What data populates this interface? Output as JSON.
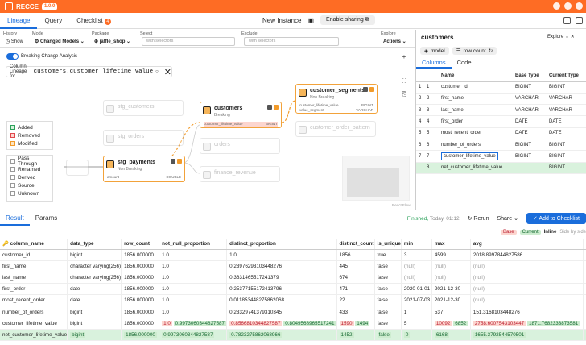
{
  "app": {
    "name": "RECCE",
    "version": "1.0.0"
  },
  "nav": {
    "tabs": [
      "Lineage",
      "Query",
      "Checklist"
    ],
    "checklist_count": "4",
    "title": "New Instance",
    "share": "Enable sharing"
  },
  "filters": {
    "history_label": "History",
    "history_value": "Show",
    "mode_label": "Mode",
    "mode_value": "Changed Models",
    "package_label": "Package",
    "package_value": "jaffle_shop",
    "select_label": "Select",
    "select_placeholder": "with selectors",
    "exclude_label": "Exclude",
    "exclude_placeholder": "with selectors",
    "explore_label": "Explore",
    "actions_value": "Actions"
  },
  "canvas": {
    "breaking_label": "Breaking Change Analysis",
    "column_lineage_label": "Column Lineage for",
    "column_lineage_value": "customers.customer_lifetime_value",
    "legend1": [
      "Added",
      "Removed",
      "Modified"
    ],
    "legend1_colors": [
      "#2ba15a",
      "#e0474c",
      "#f29b2a"
    ],
    "legend2": [
      "Pass Through",
      "Renamed",
      "Derived",
      "Source",
      "Unknown"
    ],
    "react_flow": "React Flow",
    "nodes": {
      "stg_customers": {
        "title": "stg_customers"
      },
      "stg_orders": {
        "title": "stg_orders"
      },
      "stg_payments": {
        "title": "stg_payments",
        "sub": "Non Breaking",
        "col": "amount",
        "type": "DOUBLE"
      },
      "customers": {
        "title": "customers",
        "sub": "Breaking",
        "col": "customer_lifetime_value",
        "type": "BIGINT"
      },
      "customer_segments": {
        "title": "customer_segments",
        "sub": "Non Breaking",
        "col1": "customer_lifetime_value",
        "type1": "BIGINT",
        "col2": "value_segment",
        "type2": "VARCHAR"
      },
      "customer_order_pattern": {
        "title": "customer_order_pattern"
      },
      "orders": {
        "title": "orders"
      },
      "finance_revenue": {
        "title": "finance_revenue"
      }
    }
  },
  "right_panel": {
    "title": "customers",
    "explore": "Explore",
    "badges": [
      "model",
      "row count"
    ],
    "tabs": [
      "Columns",
      "Code"
    ],
    "headers": [
      "",
      "",
      "Name",
      "Base Type",
      "Current Type"
    ],
    "rows": [
      {
        "a": "1",
        "b": "1",
        "name": "customer_id",
        "base": "BIGINT",
        "cur": "BIGINT"
      },
      {
        "a": "2",
        "b": "2",
        "name": "first_name",
        "base": "VARCHAR",
        "cur": "VARCHAR"
      },
      {
        "a": "3",
        "b": "3",
        "name": "last_name",
        "base": "VARCHAR",
        "cur": "VARCHAR"
      },
      {
        "a": "4",
        "b": "4",
        "name": "first_order",
        "base": "DATE",
        "cur": "DATE"
      },
      {
        "a": "5",
        "b": "5",
        "name": "most_recent_order",
        "base": "DATE",
        "cur": "DATE"
      },
      {
        "a": "6",
        "b": "6",
        "name": "number_of_orders",
        "base": "BIGINT",
        "cur": "BIGINT"
      },
      {
        "a": "7",
        "b": "7",
        "name": "customer_lifetime_value",
        "base": "BIGINT",
        "cur": "BIGINT"
      },
      {
        "a": "",
        "b": "8",
        "name": "net_customer_lifetime_value",
        "base": "",
        "cur": "BIGINT"
      }
    ]
  },
  "result": {
    "tabs": [
      "Result",
      "Params"
    ],
    "finished": "Finished",
    "time": "Today, 01:12",
    "rerun": "Rerun",
    "share": "Share",
    "add_checklist": "Add to Checklist",
    "base_label": "Base",
    "current_label": "Current",
    "inline_label": "Inline",
    "sbs_label": "Side by side",
    "headers": [
      "column_name",
      "data_type",
      "row_count",
      "not_null_proportion",
      "distinct_proportion",
      "distinct_count",
      "is_unique",
      "min",
      "max",
      "avg"
    ],
    "rows": [
      [
        "customer_id",
        "bigint",
        "1856.000000",
        "1.0",
        "1.0",
        "1856",
        "true",
        "3",
        "4599",
        "2018.8997844827586"
      ],
      [
        "first_name",
        "character varying(256)",
        "1856.000000",
        "1.0",
        "0.23976293103448276",
        "445",
        "false",
        "(null)",
        "(null)",
        "(null)"
      ],
      [
        "last_name",
        "character varying(256)",
        "1856.000000",
        "1.0",
        "0.3631465517241379",
        "674",
        "false",
        "(null)",
        "(null)",
        "(null)"
      ],
      [
        "first_order",
        "date",
        "1856.000000",
        "1.0",
        "0.25377155172413796",
        "471",
        "false",
        "2020-01-01",
        "2021-12-30",
        "(null)"
      ],
      [
        "most_recent_order",
        "date",
        "1856.000000",
        "1.0",
        "0.011853448275862068",
        "22",
        "false",
        "2021-07-03",
        "2021-12-30",
        "(null)"
      ],
      [
        "number_of_orders",
        "bigint",
        "1856.000000",
        "1.0",
        "0.23329741379310345",
        "433",
        "false",
        "1",
        "537",
        "151.3168103448276"
      ]
    ],
    "clv": {
      "name": "customer_lifetime_value",
      "type": "bigint",
      "row_count": "1856.000000",
      "nn_base": "1.0",
      "nn_cur": "0.9973060344827587",
      "dp_base": "0.8566810344827587",
      "dp_cur": "0.8049568965517241",
      "dc_base": "1590",
      "dc_cur": "1494",
      "unique": "false",
      "min": "5",
      "max_base": "10092",
      "max_cur": "6852",
      "avg_base": "2758.6007543103447",
      "avg_cur": "1871.7682333873581"
    },
    "net": {
      "name": "net_customer_lifetime_value",
      "type": "bigint",
      "row_count": "1856.000000",
      "nn": "0.9973060344827587",
      "dp": "0.7823275862068966",
      "dc": "1452",
      "unique": "false",
      "min": "0",
      "max": "6168",
      "avg": "1655.3792544570501"
    }
  }
}
